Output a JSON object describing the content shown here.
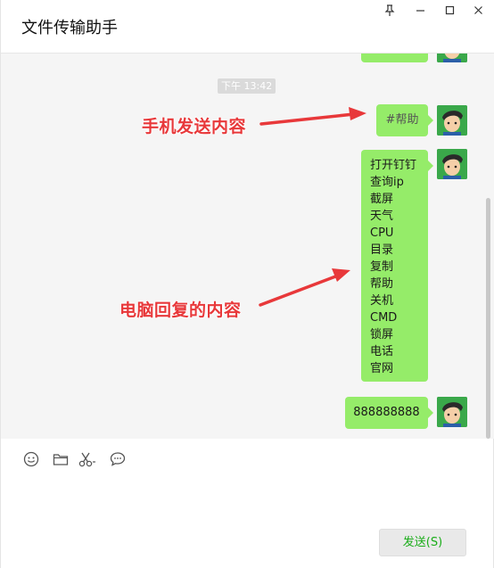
{
  "window": {
    "title": "文件传输助手",
    "controls": {
      "pin_icon": "pin-icon",
      "minimize_icon": "minimize-icon",
      "maximize_icon": "maximize-icon",
      "close_icon": "close-icon"
    }
  },
  "chat": {
    "timestamp": "下午 13:42",
    "messages": [
      {
        "from": "self",
        "text": "#帮助"
      },
      {
        "from": "self",
        "lines": [
          "打开钉钉",
          "查询ip",
          "截屏",
          "天气",
          "CPU",
          "目录",
          "复制",
          "帮助",
          "关机",
          "CMD",
          "锁屏",
          "电话",
          "官网"
        ]
      },
      {
        "from": "self",
        "text": "888888888"
      }
    ]
  },
  "annotations": {
    "phone_sent": "手机发送内容",
    "pc_reply": "电脑回复的内容",
    "color": "#e8383a"
  },
  "toolbar": {
    "emoji_icon": "emoji-icon",
    "folder_icon": "folder-icon",
    "screenshot_icon": "scissors-icon",
    "chat_history_icon": "chat-bubble-icon"
  },
  "input": {
    "value": "",
    "send_label": "发送(S)"
  },
  "colors": {
    "bubble": "#95ec69",
    "chat_bg": "#f5f5f5",
    "send_text": "#1aad19"
  }
}
